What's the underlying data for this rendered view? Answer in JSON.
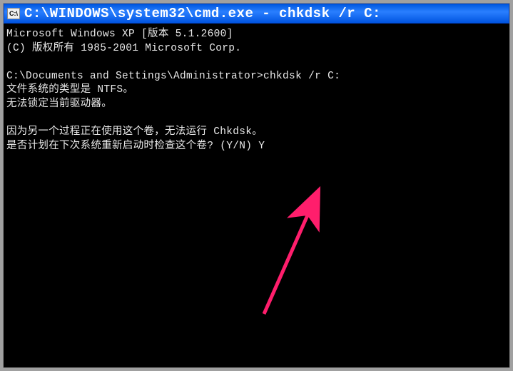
{
  "titlebar": {
    "icon_label": "C:\\",
    "title": "C:\\WINDOWS\\system32\\cmd.exe - chkdsk /r C:"
  },
  "terminal": {
    "line1": "Microsoft Windows XP [版本 5.1.2600]",
    "line2": "(C) 版权所有 1985-2001 Microsoft Corp.",
    "blank1": "",
    "line3": "C:\\Documents and Settings\\Administrator>chkdsk /r C:",
    "line4": "文件系统的类型是 NTFS。",
    "line5": "无法锁定当前驱动器。",
    "blank2": "",
    "line6": "因为另一个过程正在使用这个卷，无法运行 Chkdsk。",
    "line7": "是否计划在下次系统重新启动时检查这个卷? (Y/N) Y"
  },
  "annotation": {
    "type": "arrow",
    "color": "#ff1e6c"
  }
}
